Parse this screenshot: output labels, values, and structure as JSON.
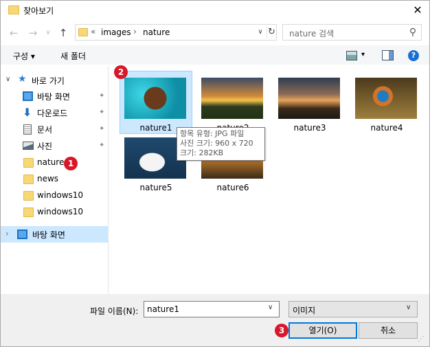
{
  "window": {
    "title": "찾아보기",
    "close_glyph": "✕"
  },
  "nav": {
    "back_glyph": "←",
    "forward_glyph": "→",
    "recent_glyph": "∨",
    "up_glyph": "↑"
  },
  "address": {
    "overflow": "«",
    "segments": [
      "images",
      "nature"
    ],
    "separator": "›",
    "drop_glyph": "∨",
    "refresh_glyph": "↻"
  },
  "search": {
    "placeholder": "nature 검색",
    "icon_glyph": "⚲"
  },
  "toolbar": {
    "organize_label": "구성 ▾",
    "new_folder_label": "새 폴더",
    "view_drop_glyph": "▾",
    "help_glyph": "?"
  },
  "sidebar": {
    "quick_access": {
      "label": "바로 가기",
      "chevron": "∨",
      "star": "★"
    },
    "items": [
      {
        "label": "바탕 화면",
        "icon": "desktop-icon",
        "pinned": true
      },
      {
        "label": "다운로드",
        "icon": "download-icon",
        "pinned": true
      },
      {
        "label": "문서",
        "icon": "document-icon",
        "pinned": true
      },
      {
        "label": "사진",
        "icon": "pictures-icon",
        "pinned": true
      },
      {
        "label": "nature",
        "icon": "folder-icon",
        "pinned": false
      },
      {
        "label": "news",
        "icon": "folder-icon",
        "pinned": false
      },
      {
        "label": "windows10",
        "icon": "folder-icon",
        "pinned": false
      },
      {
        "label": "windows10",
        "icon": "folder-icon",
        "pinned": false
      }
    ],
    "desktop_root": {
      "label": "바탕 화면",
      "chevron": "›",
      "selected": true
    },
    "pin_glyph": "✦"
  },
  "files": [
    {
      "name": "nature1",
      "selected": true
    },
    {
      "name": "nature2",
      "selected": false
    },
    {
      "name": "nature3",
      "selected": false
    },
    {
      "name": "nature4",
      "selected": false
    },
    {
      "name": "nature5",
      "selected": false
    },
    {
      "name": "nature6",
      "selected": false
    }
  ],
  "tooltip": {
    "line1": "항목 유형: JPG 파일",
    "line2": "사진 크기: 960 x 720",
    "line3": "크기: 282KB"
  },
  "footer": {
    "filename_label": "파일 이름(N):",
    "filename_value": "nature1",
    "filetype_value": "이미지",
    "open_label": "열기(O)",
    "cancel_label": "취소",
    "drop_glyph": "∨"
  },
  "badges": {
    "b1": "1",
    "b2": "2",
    "b3": "3"
  },
  "colors": {
    "accent": "#0078d7",
    "selection": "#cce8ff",
    "badge": "#d8172a",
    "folder": "#f8d776"
  }
}
